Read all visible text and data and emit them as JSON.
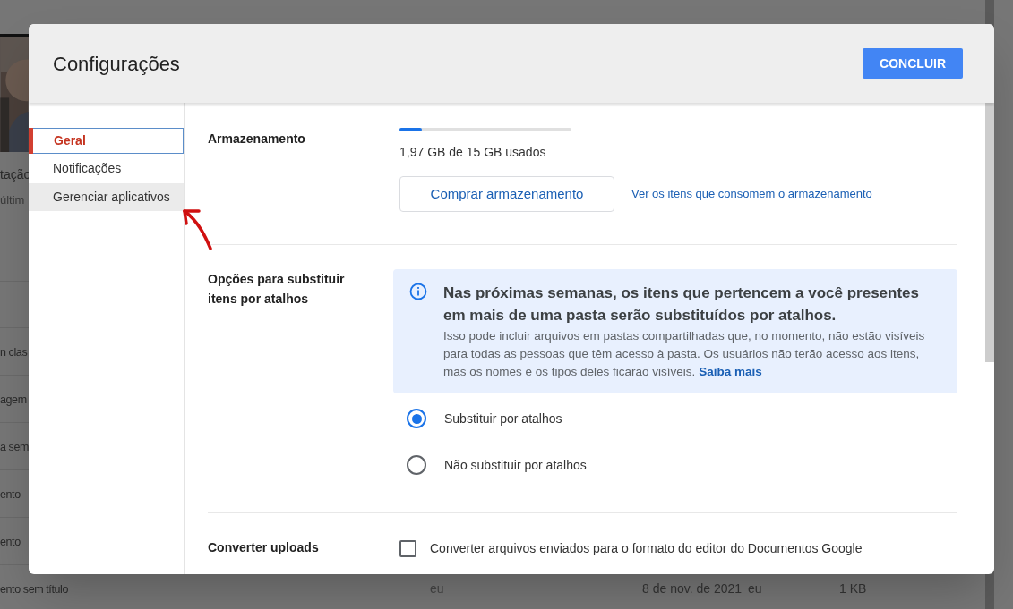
{
  "background_files": [
    {
      "name": "tação",
      "detail": "últim"
    },
    {
      "name": "n clas"
    },
    {
      "name": "agem"
    },
    {
      "name": "a sem"
    },
    {
      "name": "ento"
    },
    {
      "name": "ento"
    },
    {
      "name": "ento sem título",
      "owner": "eu",
      "modified": "8 de nov. de 2021",
      "modified_by": "eu",
      "size": "1 KB"
    }
  ],
  "dialog": {
    "title": "Configurações",
    "done_button": "CONCLUIR",
    "nav": [
      {
        "label": "Geral",
        "selected": true,
        "highlighted": false
      },
      {
        "label": "Notificações",
        "selected": false,
        "highlighted": false
      },
      {
        "label": "Gerenciar aplicativos",
        "selected": false,
        "highlighted": true
      }
    ],
    "storage": {
      "label": "Armazenamento",
      "level": 0.13,
      "usage": "1,97 GB de 15 GB usados",
      "buy_button": "Comprar armazenamento",
      "link": "Ver os itens que consomem o armazenamento"
    },
    "shortcuts": {
      "label": "Opções para substituir itens por atalhos",
      "notice_title": "Nas próximas semanas, os itens que pertencem a você presentes em mais de uma pasta serão substituídos por atalhos.",
      "notice_body": "Isso pode incluir arquivos em pastas compartilhadas que, no momento, não estão visíveis para todas as pessoas que têm acesso à pasta. Os usuários não terão acesso aos itens, mas os nomes e os tipos deles ficarão visíveis.",
      "notice_link": "Saiba mais",
      "options": [
        {
          "label": "Substituir por atalhos",
          "selected": true
        },
        {
          "label": "Não substituir por atalhos",
          "selected": false
        }
      ]
    },
    "convert": {
      "label": "Converter uploads",
      "option": "Converter arquivos enviados para o formato do editor do Documentos Google",
      "checked": false
    }
  }
}
